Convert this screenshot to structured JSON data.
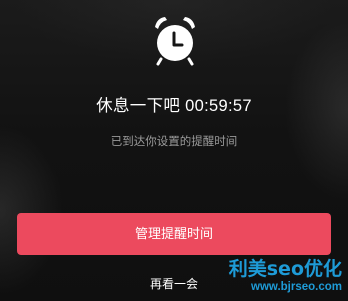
{
  "alarm": {
    "icon": "alarm-clock-icon",
    "headline": "休息一下吧",
    "countdown": "00:59:57",
    "subtitle": "已到达你设置的提醒时间"
  },
  "actions": {
    "manage_label": "管理提醒时间",
    "snooze_label": "再看一会",
    "accent_color": "#ec4a5e"
  },
  "watermark": {
    "title": "利美seo优化",
    "url": "www.bjrseo.com",
    "color": "#1e9bd7"
  }
}
